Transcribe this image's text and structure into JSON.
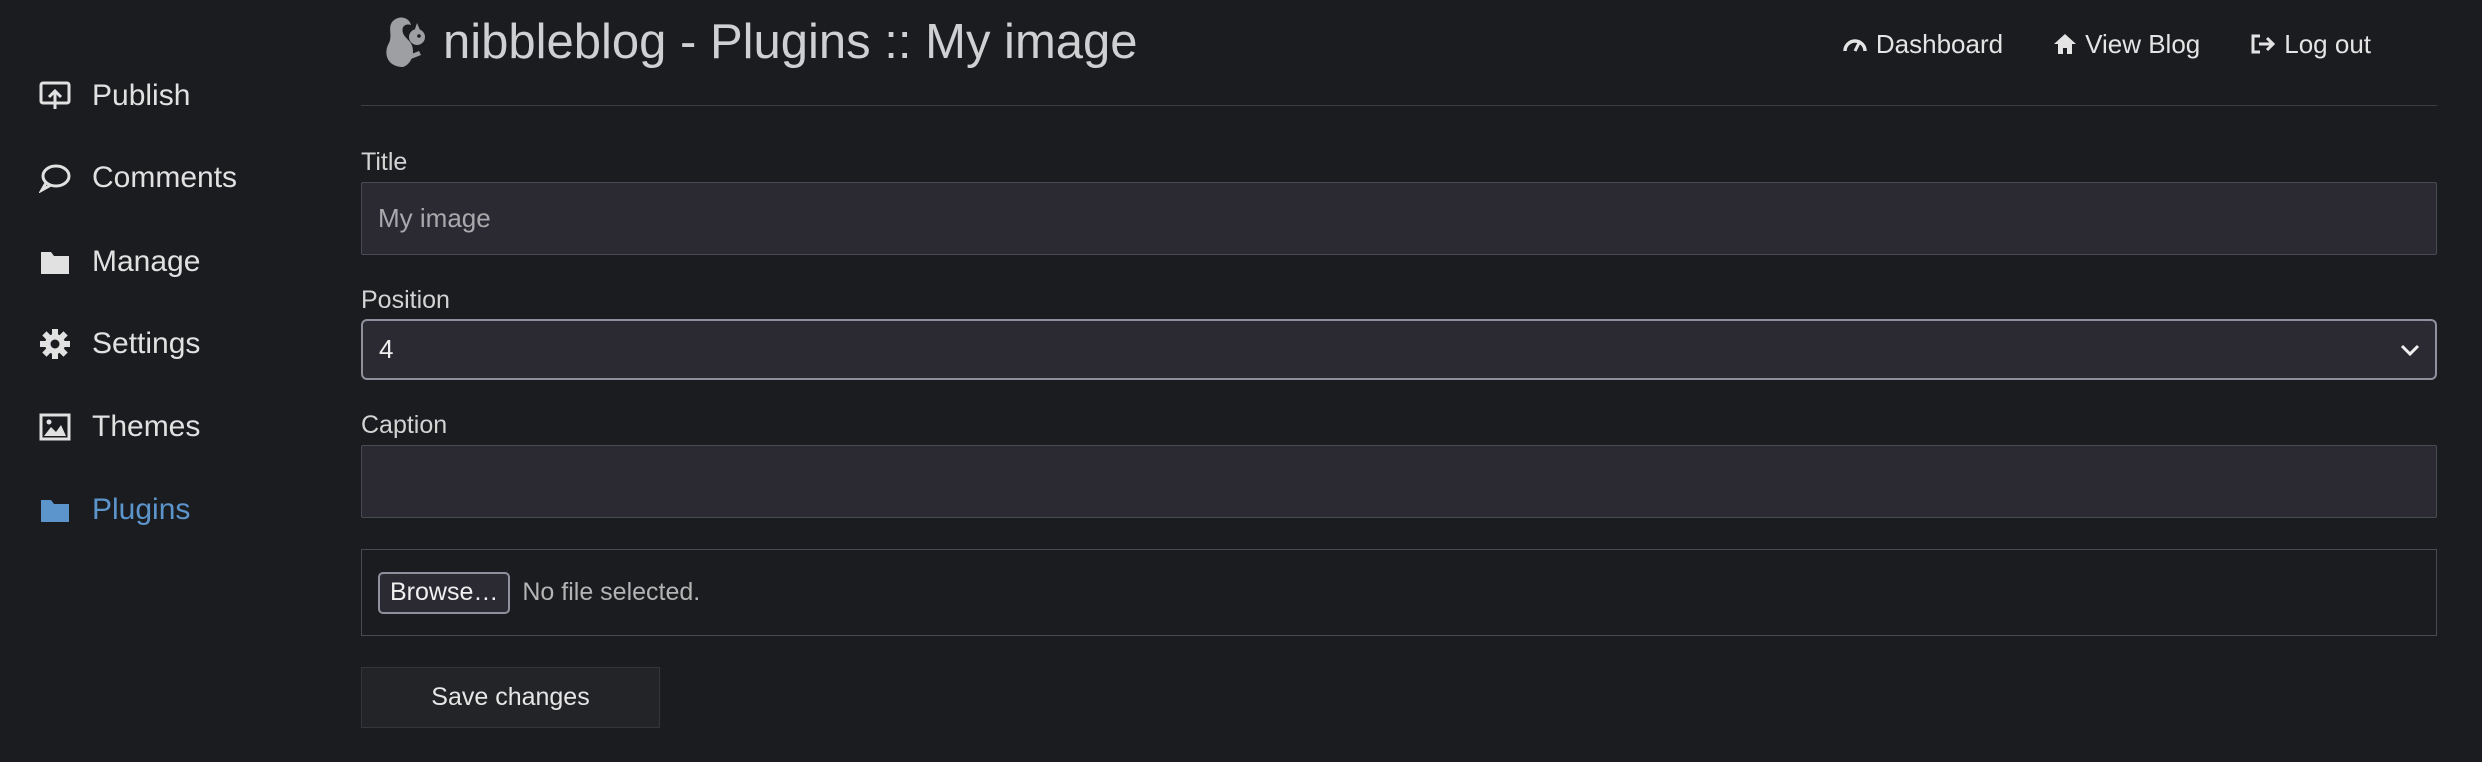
{
  "sidebar": {
    "items": [
      {
        "label": "Publish",
        "icon": "publish-icon",
        "active": false
      },
      {
        "label": "Comments",
        "icon": "comment-icon",
        "active": false
      },
      {
        "label": "Manage",
        "icon": "folder-icon",
        "active": false
      },
      {
        "label": "Settings",
        "icon": "gear-icon",
        "active": false
      },
      {
        "label": "Themes",
        "icon": "image-icon",
        "active": false
      },
      {
        "label": "Plugins",
        "icon": "folder-icon",
        "active": true
      }
    ],
    "active_color": "#5c95cc"
  },
  "header": {
    "title": "nibbleblog - Plugins :: My image",
    "logo_icon": "squirrel-logo-icon",
    "links": [
      {
        "label": "Dashboard",
        "icon": "dashboard-icon"
      },
      {
        "label": "View Blog",
        "icon": "home-icon"
      },
      {
        "label": "Log out",
        "icon": "logout-icon"
      }
    ]
  },
  "form": {
    "title_label": "Title",
    "title_value": "My image",
    "position_label": "Position",
    "position_value": "4",
    "caption_label": "Caption",
    "caption_value": "",
    "browse_label": "Browse…",
    "file_status": "No file selected.",
    "save_label": "Save changes"
  }
}
